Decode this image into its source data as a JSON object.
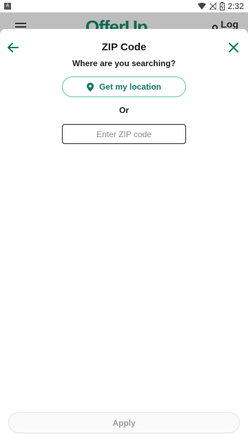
{
  "status_bar": {
    "time": "2:32",
    "icons": [
      "notification-icon",
      "wifi-icon",
      "signal-icon",
      "battery-icon"
    ]
  },
  "background_app": {
    "logo": "OfferUp",
    "login": "Log"
  },
  "sheet": {
    "title": "ZIP Code",
    "subtitle": "Where are you searching?",
    "location_button": "Get my location",
    "or_text": "Or",
    "zip_placeholder": "Enter ZIP code",
    "zip_value": "",
    "apply_button": "Apply"
  },
  "colors": {
    "accent": "#0a7d5e",
    "accent_border": "#5cc3a8",
    "disabled_text": "#9a9a9a"
  }
}
